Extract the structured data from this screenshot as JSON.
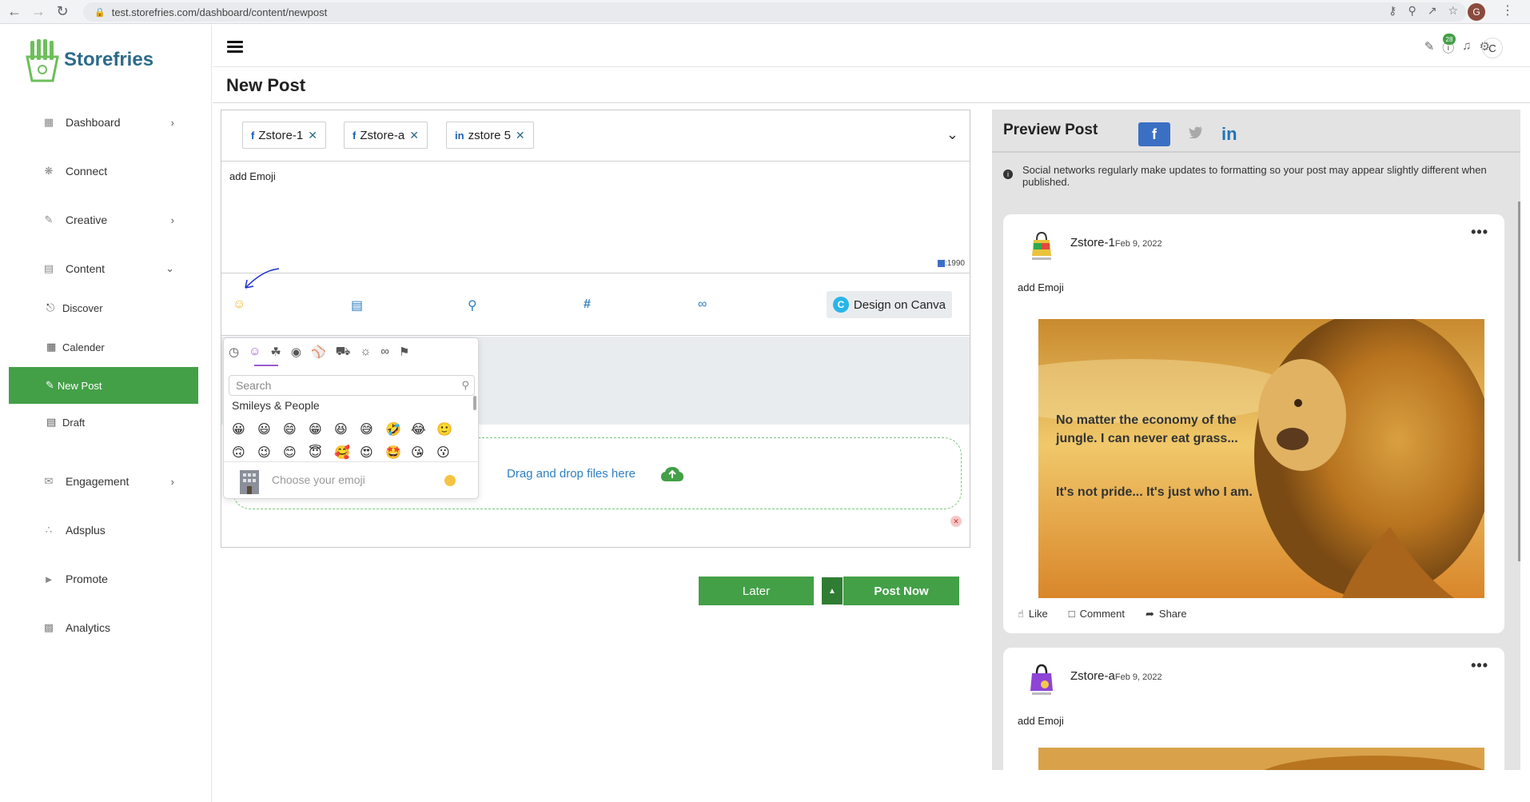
{
  "browser": {
    "url": "test.storefries.com/dashboard/content/newpost",
    "profile_initial": "G"
  },
  "sidebar": {
    "logo_text": "Storefries",
    "items": [
      {
        "label": "Dashboard",
        "icon": "grid-icon"
      },
      {
        "label": "Connect",
        "icon": "network-icon"
      },
      {
        "label": "Creative",
        "icon": "brush-icon"
      },
      {
        "label": "Content",
        "icon": "document-icon"
      },
      {
        "label": "Engagement",
        "icon": "chat-icon"
      },
      {
        "label": "Adsplus",
        "icon": "nodes-icon"
      },
      {
        "label": "Promote",
        "icon": "megaphone-icon"
      },
      {
        "label": "Analytics",
        "icon": "bar-chart-icon"
      }
    ],
    "content_sub": [
      {
        "label": "Discover"
      },
      {
        "label": "Calender"
      },
      {
        "label": "New Post"
      },
      {
        "label": "Draft"
      }
    ]
  },
  "header": {
    "notification_count": "28",
    "user_initial": "C"
  },
  "page": {
    "title": "New Post"
  },
  "composer": {
    "accounts": [
      {
        "network": "f",
        "name": "Zstore-1"
      },
      {
        "network": "f",
        "name": "Zstore-a"
      },
      {
        "network": "in",
        "name": "zstore 5"
      }
    ],
    "text": "add Emoji",
    "char_count": ":1990",
    "canva_label": "Design on Canva",
    "canva_logo": "C",
    "drop_text": "Drag and drop files here"
  },
  "emoji_picker": {
    "search_placeholder": "Search",
    "section_title": "Smileys & People",
    "footer_placeholder": "Choose your emoji",
    "emojis": [
      "😀",
      "😃",
      "😄",
      "😁",
      "😆",
      "😅",
      "🤣",
      "😂",
      "🙂",
      "🙃",
      "😉",
      "😊",
      "😇",
      "🥰",
      "😍",
      "🤩",
      "😘",
      "😗"
    ]
  },
  "actions": {
    "later_label": "Later",
    "post_now_label": "Post Now"
  },
  "preview": {
    "title": "Preview Post",
    "note": "Social networks regularly make updates to formatting so your post may appear slightly different when published.",
    "tabs": {
      "facebook": "f",
      "linkedin": "in"
    },
    "posts": [
      {
        "name": "Zstore-1",
        "date": "Feb 9, 2022",
        "text": "add Emoji",
        "image_quote_1": "No matter the economy of the jungle. I can never eat grass...",
        "image_quote_2": "It's not pride... It's just who I am."
      },
      {
        "name": "Zstore-a",
        "date": "Feb 9, 2022",
        "text": "add Emoji"
      }
    ],
    "like_label": "Like",
    "comment_label": "Comment",
    "share_label": "Share"
  },
  "colors": {
    "brand_green": "#43a047",
    "link_blue": "#2f7fc0",
    "facebook_blue": "#3b6fc4",
    "linkedin_blue": "#1f74b5"
  }
}
